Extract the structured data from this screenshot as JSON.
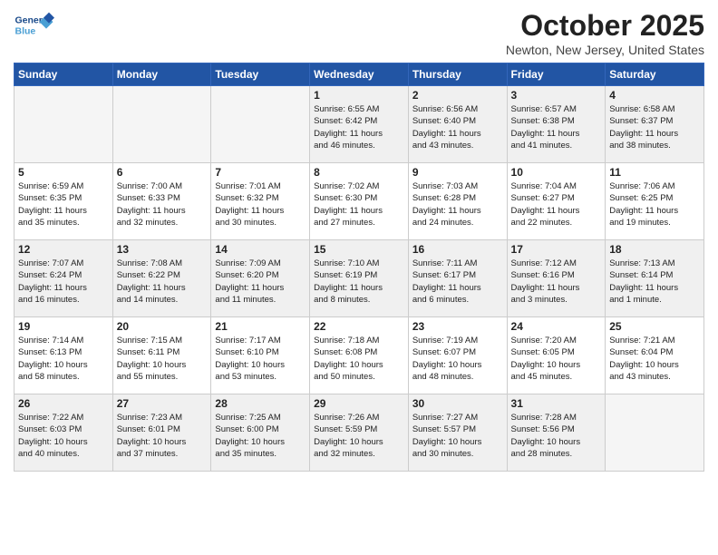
{
  "header": {
    "logo_line1": "General",
    "logo_line2": "Blue",
    "month": "October 2025",
    "location": "Newton, New Jersey, United States"
  },
  "days_of_week": [
    "Sunday",
    "Monday",
    "Tuesday",
    "Wednesday",
    "Thursday",
    "Friday",
    "Saturday"
  ],
  "weeks": [
    [
      {
        "day": "",
        "info": "",
        "empty": true
      },
      {
        "day": "",
        "info": "",
        "empty": true
      },
      {
        "day": "",
        "info": "",
        "empty": true
      },
      {
        "day": "1",
        "info": "Sunrise: 6:55 AM\nSunset: 6:42 PM\nDaylight: 11 hours\nand 46 minutes.",
        "empty": false
      },
      {
        "day": "2",
        "info": "Sunrise: 6:56 AM\nSunset: 6:40 PM\nDaylight: 11 hours\nand 43 minutes.",
        "empty": false
      },
      {
        "day": "3",
        "info": "Sunrise: 6:57 AM\nSunset: 6:38 PM\nDaylight: 11 hours\nand 41 minutes.",
        "empty": false
      },
      {
        "day": "4",
        "info": "Sunrise: 6:58 AM\nSunset: 6:37 PM\nDaylight: 11 hours\nand 38 minutes.",
        "empty": false
      }
    ],
    [
      {
        "day": "5",
        "info": "Sunrise: 6:59 AM\nSunset: 6:35 PM\nDaylight: 11 hours\nand 35 minutes.",
        "empty": false
      },
      {
        "day": "6",
        "info": "Sunrise: 7:00 AM\nSunset: 6:33 PM\nDaylight: 11 hours\nand 32 minutes.",
        "empty": false
      },
      {
        "day": "7",
        "info": "Sunrise: 7:01 AM\nSunset: 6:32 PM\nDaylight: 11 hours\nand 30 minutes.",
        "empty": false
      },
      {
        "day": "8",
        "info": "Sunrise: 7:02 AM\nSunset: 6:30 PM\nDaylight: 11 hours\nand 27 minutes.",
        "empty": false
      },
      {
        "day": "9",
        "info": "Sunrise: 7:03 AM\nSunset: 6:28 PM\nDaylight: 11 hours\nand 24 minutes.",
        "empty": false
      },
      {
        "day": "10",
        "info": "Sunrise: 7:04 AM\nSunset: 6:27 PM\nDaylight: 11 hours\nand 22 minutes.",
        "empty": false
      },
      {
        "day": "11",
        "info": "Sunrise: 7:06 AM\nSunset: 6:25 PM\nDaylight: 11 hours\nand 19 minutes.",
        "empty": false
      }
    ],
    [
      {
        "day": "12",
        "info": "Sunrise: 7:07 AM\nSunset: 6:24 PM\nDaylight: 11 hours\nand 16 minutes.",
        "empty": false
      },
      {
        "day": "13",
        "info": "Sunrise: 7:08 AM\nSunset: 6:22 PM\nDaylight: 11 hours\nand 14 minutes.",
        "empty": false
      },
      {
        "day": "14",
        "info": "Sunrise: 7:09 AM\nSunset: 6:20 PM\nDaylight: 11 hours\nand 11 minutes.",
        "empty": false
      },
      {
        "day": "15",
        "info": "Sunrise: 7:10 AM\nSunset: 6:19 PM\nDaylight: 11 hours\nand 8 minutes.",
        "empty": false
      },
      {
        "day": "16",
        "info": "Sunrise: 7:11 AM\nSunset: 6:17 PM\nDaylight: 11 hours\nand 6 minutes.",
        "empty": false
      },
      {
        "day": "17",
        "info": "Sunrise: 7:12 AM\nSunset: 6:16 PM\nDaylight: 11 hours\nand 3 minutes.",
        "empty": false
      },
      {
        "day": "18",
        "info": "Sunrise: 7:13 AM\nSunset: 6:14 PM\nDaylight: 11 hours\nand 1 minute.",
        "empty": false
      }
    ],
    [
      {
        "day": "19",
        "info": "Sunrise: 7:14 AM\nSunset: 6:13 PM\nDaylight: 10 hours\nand 58 minutes.",
        "empty": false
      },
      {
        "day": "20",
        "info": "Sunrise: 7:15 AM\nSunset: 6:11 PM\nDaylight: 10 hours\nand 55 minutes.",
        "empty": false
      },
      {
        "day": "21",
        "info": "Sunrise: 7:17 AM\nSunset: 6:10 PM\nDaylight: 10 hours\nand 53 minutes.",
        "empty": false
      },
      {
        "day": "22",
        "info": "Sunrise: 7:18 AM\nSunset: 6:08 PM\nDaylight: 10 hours\nand 50 minutes.",
        "empty": false
      },
      {
        "day": "23",
        "info": "Sunrise: 7:19 AM\nSunset: 6:07 PM\nDaylight: 10 hours\nand 48 minutes.",
        "empty": false
      },
      {
        "day": "24",
        "info": "Sunrise: 7:20 AM\nSunset: 6:05 PM\nDaylight: 10 hours\nand 45 minutes.",
        "empty": false
      },
      {
        "day": "25",
        "info": "Sunrise: 7:21 AM\nSunset: 6:04 PM\nDaylight: 10 hours\nand 43 minutes.",
        "empty": false
      }
    ],
    [
      {
        "day": "26",
        "info": "Sunrise: 7:22 AM\nSunset: 6:03 PM\nDaylight: 10 hours\nand 40 minutes.",
        "empty": false
      },
      {
        "day": "27",
        "info": "Sunrise: 7:23 AM\nSunset: 6:01 PM\nDaylight: 10 hours\nand 37 minutes.",
        "empty": false
      },
      {
        "day": "28",
        "info": "Sunrise: 7:25 AM\nSunset: 6:00 PM\nDaylight: 10 hours\nand 35 minutes.",
        "empty": false
      },
      {
        "day": "29",
        "info": "Sunrise: 7:26 AM\nSunset: 5:59 PM\nDaylight: 10 hours\nand 32 minutes.",
        "empty": false
      },
      {
        "day": "30",
        "info": "Sunrise: 7:27 AM\nSunset: 5:57 PM\nDaylight: 10 hours\nand 30 minutes.",
        "empty": false
      },
      {
        "day": "31",
        "info": "Sunrise: 7:28 AM\nSunset: 5:56 PM\nDaylight: 10 hours\nand 28 minutes.",
        "empty": false
      },
      {
        "day": "",
        "info": "",
        "empty": true
      }
    ]
  ]
}
